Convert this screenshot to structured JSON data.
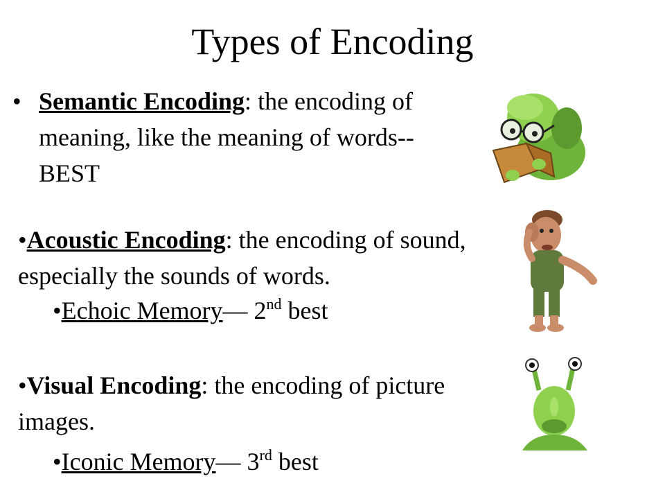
{
  "slide": {
    "title": "Types of Encoding",
    "bullet_symbol": "•",
    "semantic": {
      "term": "Semantic Encoding",
      "separator": ":",
      "definition": " the encoding of meaning, like the meaning of words--BEST"
    },
    "acoustic": {
      "term": "Acoustic Encoding",
      "separator": ":",
      "definition": " the encoding of sound, especially the sounds of words."
    },
    "echoic": {
      "term": "Echoic Memory",
      "dash": "—",
      "rank_number": "2",
      "rank_suffix": "nd",
      "rank_word": "best"
    },
    "visual": {
      "term": "Visual Encoding",
      "separator": ":",
      "definition": " the encoding of picture images."
    },
    "iconic": {
      "term": "Iconic Memory",
      "dash": "—",
      "rank_number": "3",
      "rank_suffix": "rd",
      "rank_word": "best"
    }
  },
  "images": {
    "reader": "bookworm-with-glasses-reading-icon",
    "listener": "troll-cupping-ear-icon",
    "watcher": "green-alien-eyestalks-icon"
  },
  "colors": {
    "green_light": "#8fd14f",
    "green_dark": "#4f8a2a",
    "skin": "#c98d6a",
    "overalls": "#5f7a3c",
    "book": "#c7893a"
  }
}
